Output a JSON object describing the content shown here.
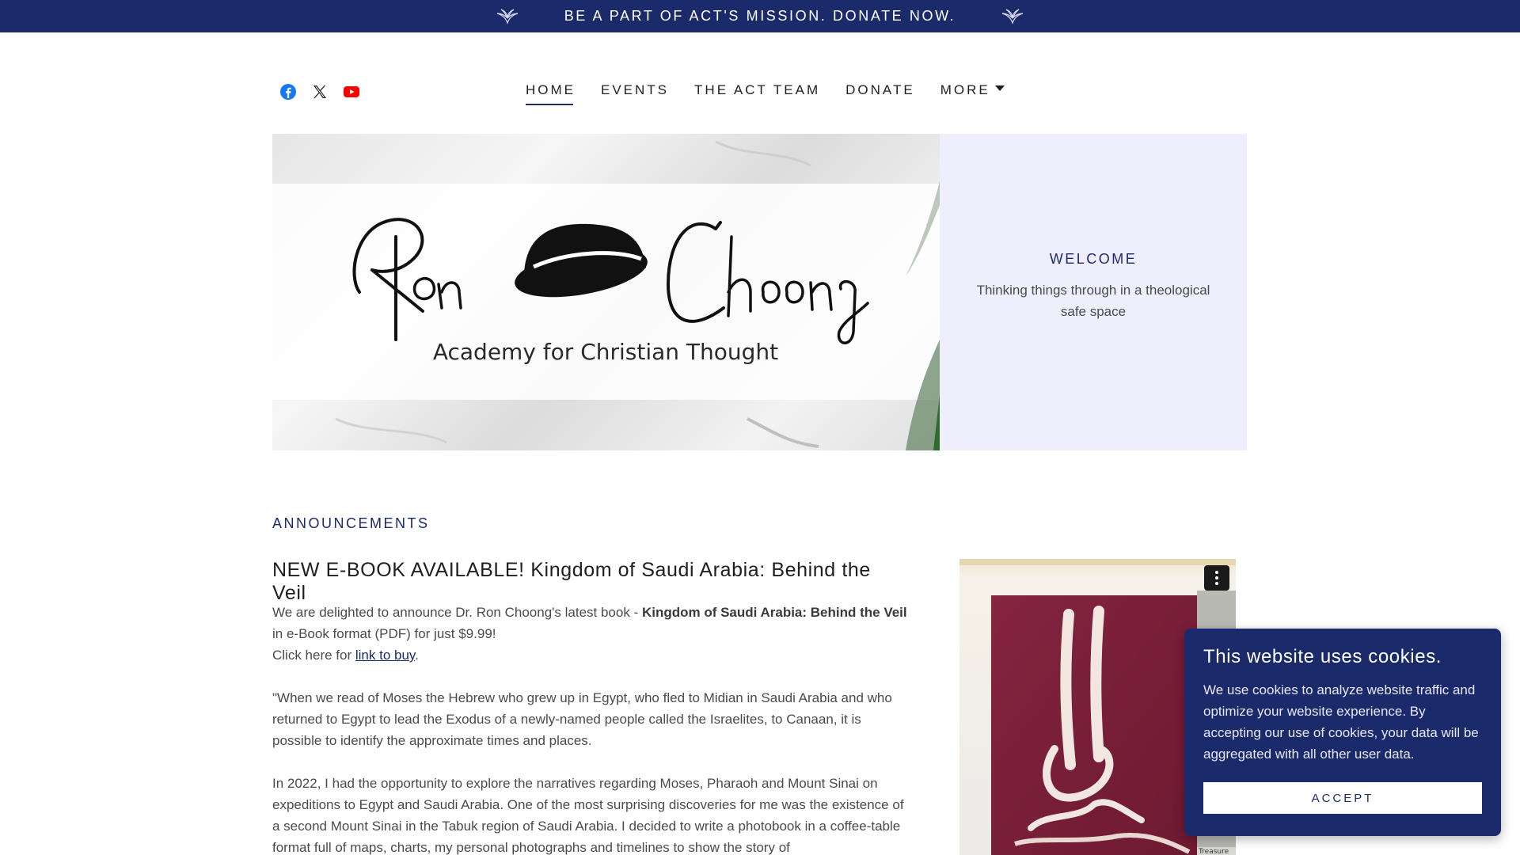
{
  "banner": {
    "text": "BE A PART OF ACT'S MISSION. DONATE NOW.",
    "icon": "dove-icon"
  },
  "social": [
    {
      "name": "facebook",
      "icon": "facebook-icon",
      "color": "#1877f2"
    },
    {
      "name": "x",
      "icon": "x-icon",
      "color": "#1f1f1f"
    },
    {
      "name": "youtube",
      "icon": "youtube-icon",
      "color": "#ff0000"
    }
  ],
  "nav": {
    "items": [
      "HOME",
      "EVENTS",
      "THE ACT TEAM",
      "DONATE"
    ],
    "more_label": "MORE",
    "active": "HOME"
  },
  "hero": {
    "logo_text_left": "Ron",
    "logo_text_right": "Choong",
    "logo_subtitle": "Academy for Christian Thought"
  },
  "welcome": {
    "title": "WELCOME",
    "text": "Thinking things through in a theological safe space"
  },
  "announcements": {
    "heading": "ANNOUNCEMENTS",
    "post_title": "NEW E-BOOK AVAILABLE! Kingdom of Saudi Arabia: Behind the Veil",
    "p1_pre": "We are delighted to announce Dr. Ron Choong's latest book - ",
    "p1_bold": "Kingdom of Saudi Arabia: Behind the Veil",
    "p1_post": " in e-Book format (PDF) for just $9.99!",
    "p2_pre": "Click here for ",
    "p2_link": "link to buy",
    "p2_post": ".",
    "p3": "\"When we read of Moses the Hebrew who grew up in Egypt, who fled to Midian in Saudi Arabia and who returned to Egypt to lead the Exodus of a newly-named people called the Israelites, to Canaan, it is possible to identify the approximate times and places.",
    "p4": "In 2022, I had the opportunity to explore the narratives regarding Moses, Pharaoh and Mount Sinai on expeditions to Egypt and Saudi Arabia. One of the most surprising discoveries for me was the existence of a second Mount Sinai in the Tabuk region of Saudi Arabia. I decided to write a photobook in a coffee-table format full of maps, charts, my personal photographs and timelines to show the story of"
  },
  "book_image": {
    "caption_fragment": "Treasure"
  },
  "cookie": {
    "title": "This website uses cookies.",
    "text": "We use cookies to analyze website traffic and optimize your website experience. By accepting our use of cookies, your data will be aggregated with all other user data.",
    "button": "ACCEPT"
  },
  "colors": {
    "brand_navy": "#1b2a6b",
    "welcome_bg": "#eeeefc"
  }
}
